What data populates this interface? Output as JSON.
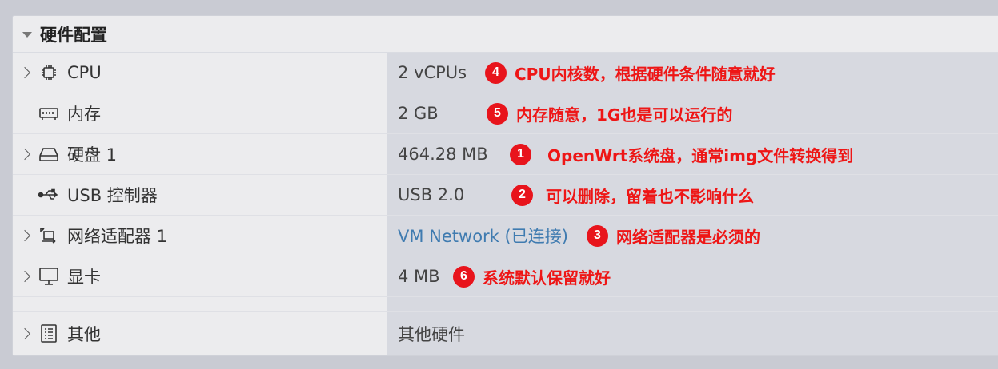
{
  "section": {
    "title": "硬件配置"
  },
  "rows": [
    {
      "label": "CPU",
      "value": "2 vCPUs",
      "badge": "4",
      "note": "CPU内核数，根据硬件条件随意就好"
    },
    {
      "label": "内存",
      "value": "2 GB",
      "badge": "5",
      "note": "内存随意，1G也是可以运行的"
    },
    {
      "label": "硬盘 1",
      "value": "464.28 MB",
      "badge": "1",
      "note": "OpenWrt系统盘，通常img文件转换得到"
    },
    {
      "label": "USB 控制器",
      "value": "USB 2.0",
      "badge": "2",
      "note": "可以删除，留着也不影响什么"
    },
    {
      "label": "网络适配器 1",
      "value": "VM Network (已连接)",
      "badge": "3",
      "note": "网络适配器是必须的"
    },
    {
      "label": "显卡",
      "value": "4 MB",
      "badge": "6",
      "note": "系统默认保留就好"
    },
    {
      "label": "其他",
      "value": "其他硬件"
    }
  ],
  "colors": {
    "annotation": "#ee1616",
    "badge": "#e8141c",
    "link": "#3f7bb0"
  }
}
